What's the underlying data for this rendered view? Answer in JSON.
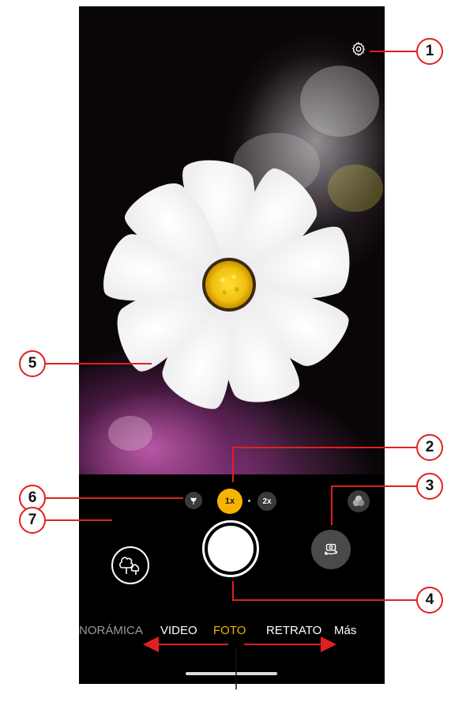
{
  "camera": {
    "zoom": {
      "macro_icon": "flower-icon",
      "zoom_1x": "1x",
      "zoom_2x": "2x",
      "filter_icon": "filter-icon"
    },
    "controls": {
      "gallery_icon": "trees-icon",
      "shutter_icon": "shutter",
      "switch_icon": "camera-switch-icon",
      "settings_icon": "gear-icon"
    },
    "modes": [
      {
        "label": "NORÁMICA"
      },
      {
        "label": "VIDEO"
      },
      {
        "label": "FOTO",
        "active": true
      },
      {
        "label": "RETRATO"
      },
      {
        "label": "Más"
      }
    ]
  },
  "callouts": [
    "1",
    "2",
    "3",
    "4",
    "5",
    "6",
    "7"
  ],
  "colors": {
    "accent": "#f5b400",
    "callout_red": "#e02020",
    "background": "#000000"
  }
}
